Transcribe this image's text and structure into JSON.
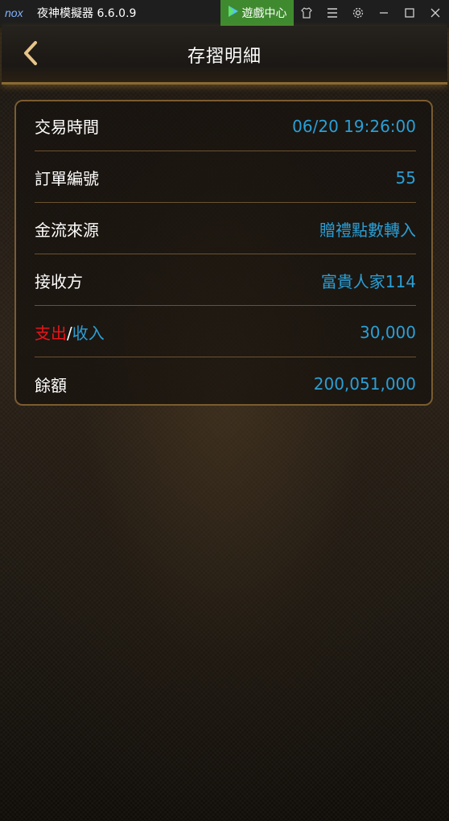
{
  "titlebar": {
    "app_name": "夜神模擬器 6.6.0.9",
    "game_center_label": "遊戲中心",
    "icons": [
      "nox-logo-icon",
      "play-store-icon",
      "shirt-icon",
      "menu-icon",
      "gear-icon",
      "minimize-icon",
      "maximize-icon",
      "close-icon"
    ]
  },
  "header": {
    "title": "存摺明細",
    "back_icon": "chevron-left-icon",
    "accent_color": "#8a6a32"
  },
  "details": {
    "time": {
      "label": "交易時間",
      "value": "06/20 19:26:00"
    },
    "order": {
      "label": "訂單編號",
      "value": "55"
    },
    "source": {
      "label": "金流來源",
      "value": "贈禮點數轉入"
    },
    "receiver": {
      "label": "接收方",
      "value": "富貴人家114"
    },
    "amount": {
      "label_expense": "支出",
      "label_sep": "/",
      "label_income": "收入",
      "value": "30,000"
    },
    "balance": {
      "label": "餘額",
      "value": "200,051,000"
    }
  },
  "colors": {
    "value_blue": "#2a9fd6",
    "expense_red": "#e8141a",
    "card_border": "#7b5c30",
    "game_center_green": "#3f8a2f"
  }
}
